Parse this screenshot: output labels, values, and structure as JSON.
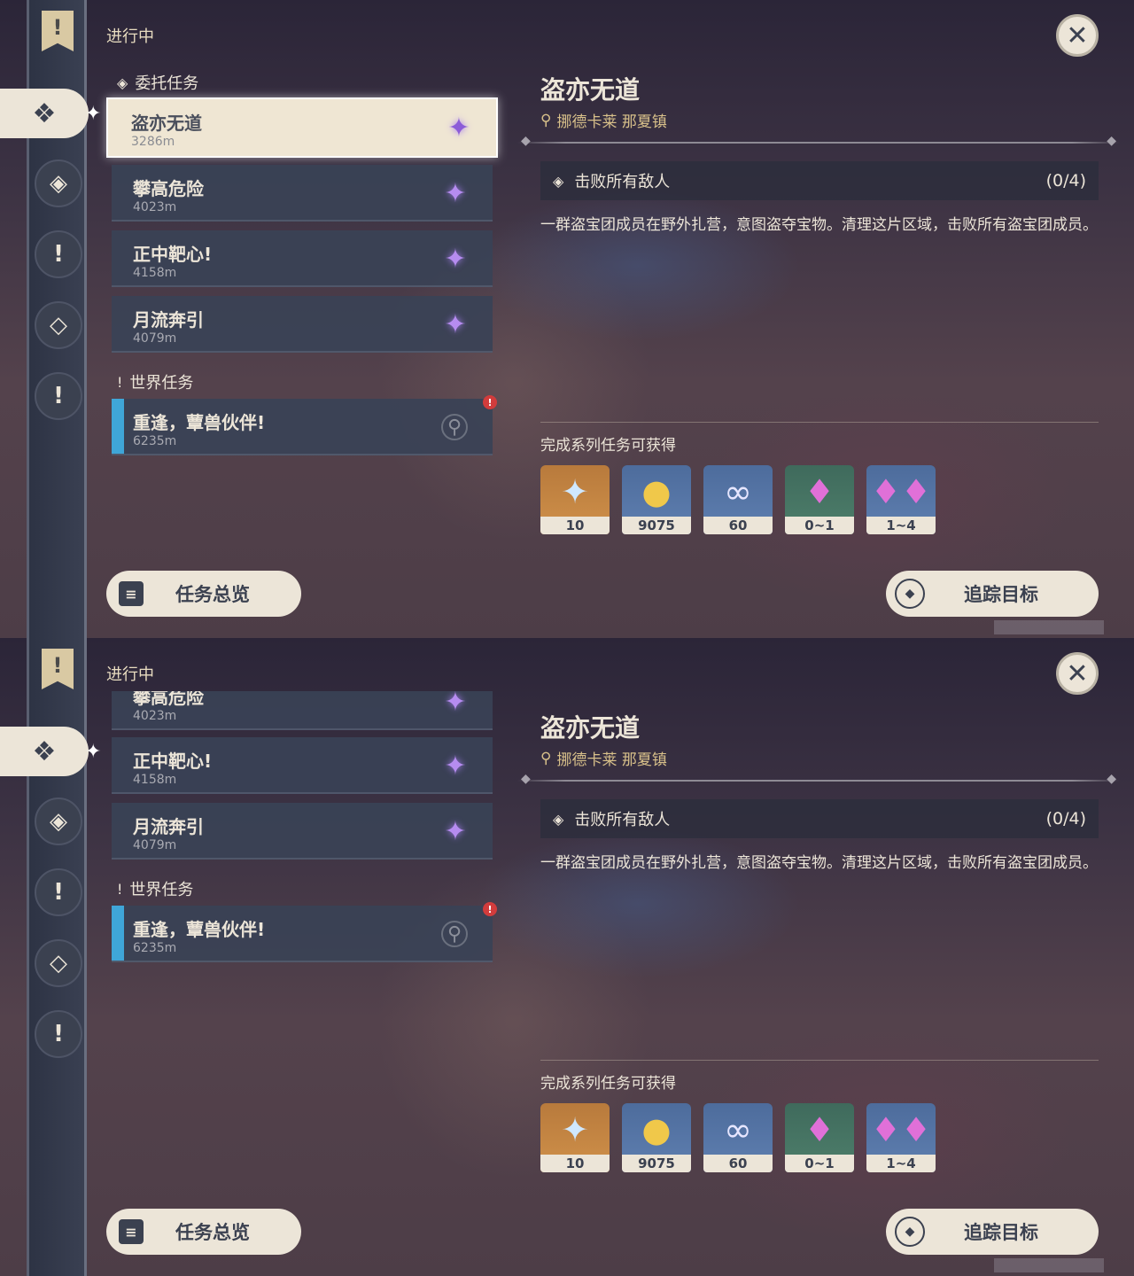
{
  "status_label": "进行中",
  "sections": {
    "commission": "委托任务",
    "world": "世界任务"
  },
  "quests": [
    {
      "name": "盗亦无道",
      "distance": "3286m"
    },
    {
      "name": "攀高危险",
      "distance": "4023m"
    },
    {
      "name": "正中靶心!",
      "distance": "4158m"
    },
    {
      "name": "月流奔引",
      "distance": "4079m"
    }
  ],
  "world_quests": [
    {
      "name": "重逢，蕈兽伙伴!",
      "distance": "6235m"
    }
  ],
  "detail": {
    "title": "盗亦无道",
    "location": "挪德卡莱 那夏镇",
    "objective": "击败所有敌人",
    "objective_progress": "(0/4)",
    "description": "一群盗宝团成员在野外扎营，意图盗夺宝物。清理这片区域，击败所有盗宝团成员。",
    "rewards_label": "完成系列任务可获得",
    "rewards": [
      {
        "icon": "primogem-icon",
        "qty": "10"
      },
      {
        "icon": "mora-icon",
        "qty": "9075"
      },
      {
        "icon": "companionship-exp-icon",
        "qty": "60"
      },
      {
        "icon": "crystal-icon",
        "qty": "0~1"
      },
      {
        "icon": "crystal-cluster-icon",
        "qty": "1~4"
      }
    ]
  },
  "buttons": {
    "overview": "任务总览",
    "track": "追踪目标"
  },
  "colors": {
    "accent_cream": "#ece5d8",
    "dark_slate": "#3b4150",
    "world_bar": "#3fa6d8",
    "location_gold": "#d8c08a"
  }
}
